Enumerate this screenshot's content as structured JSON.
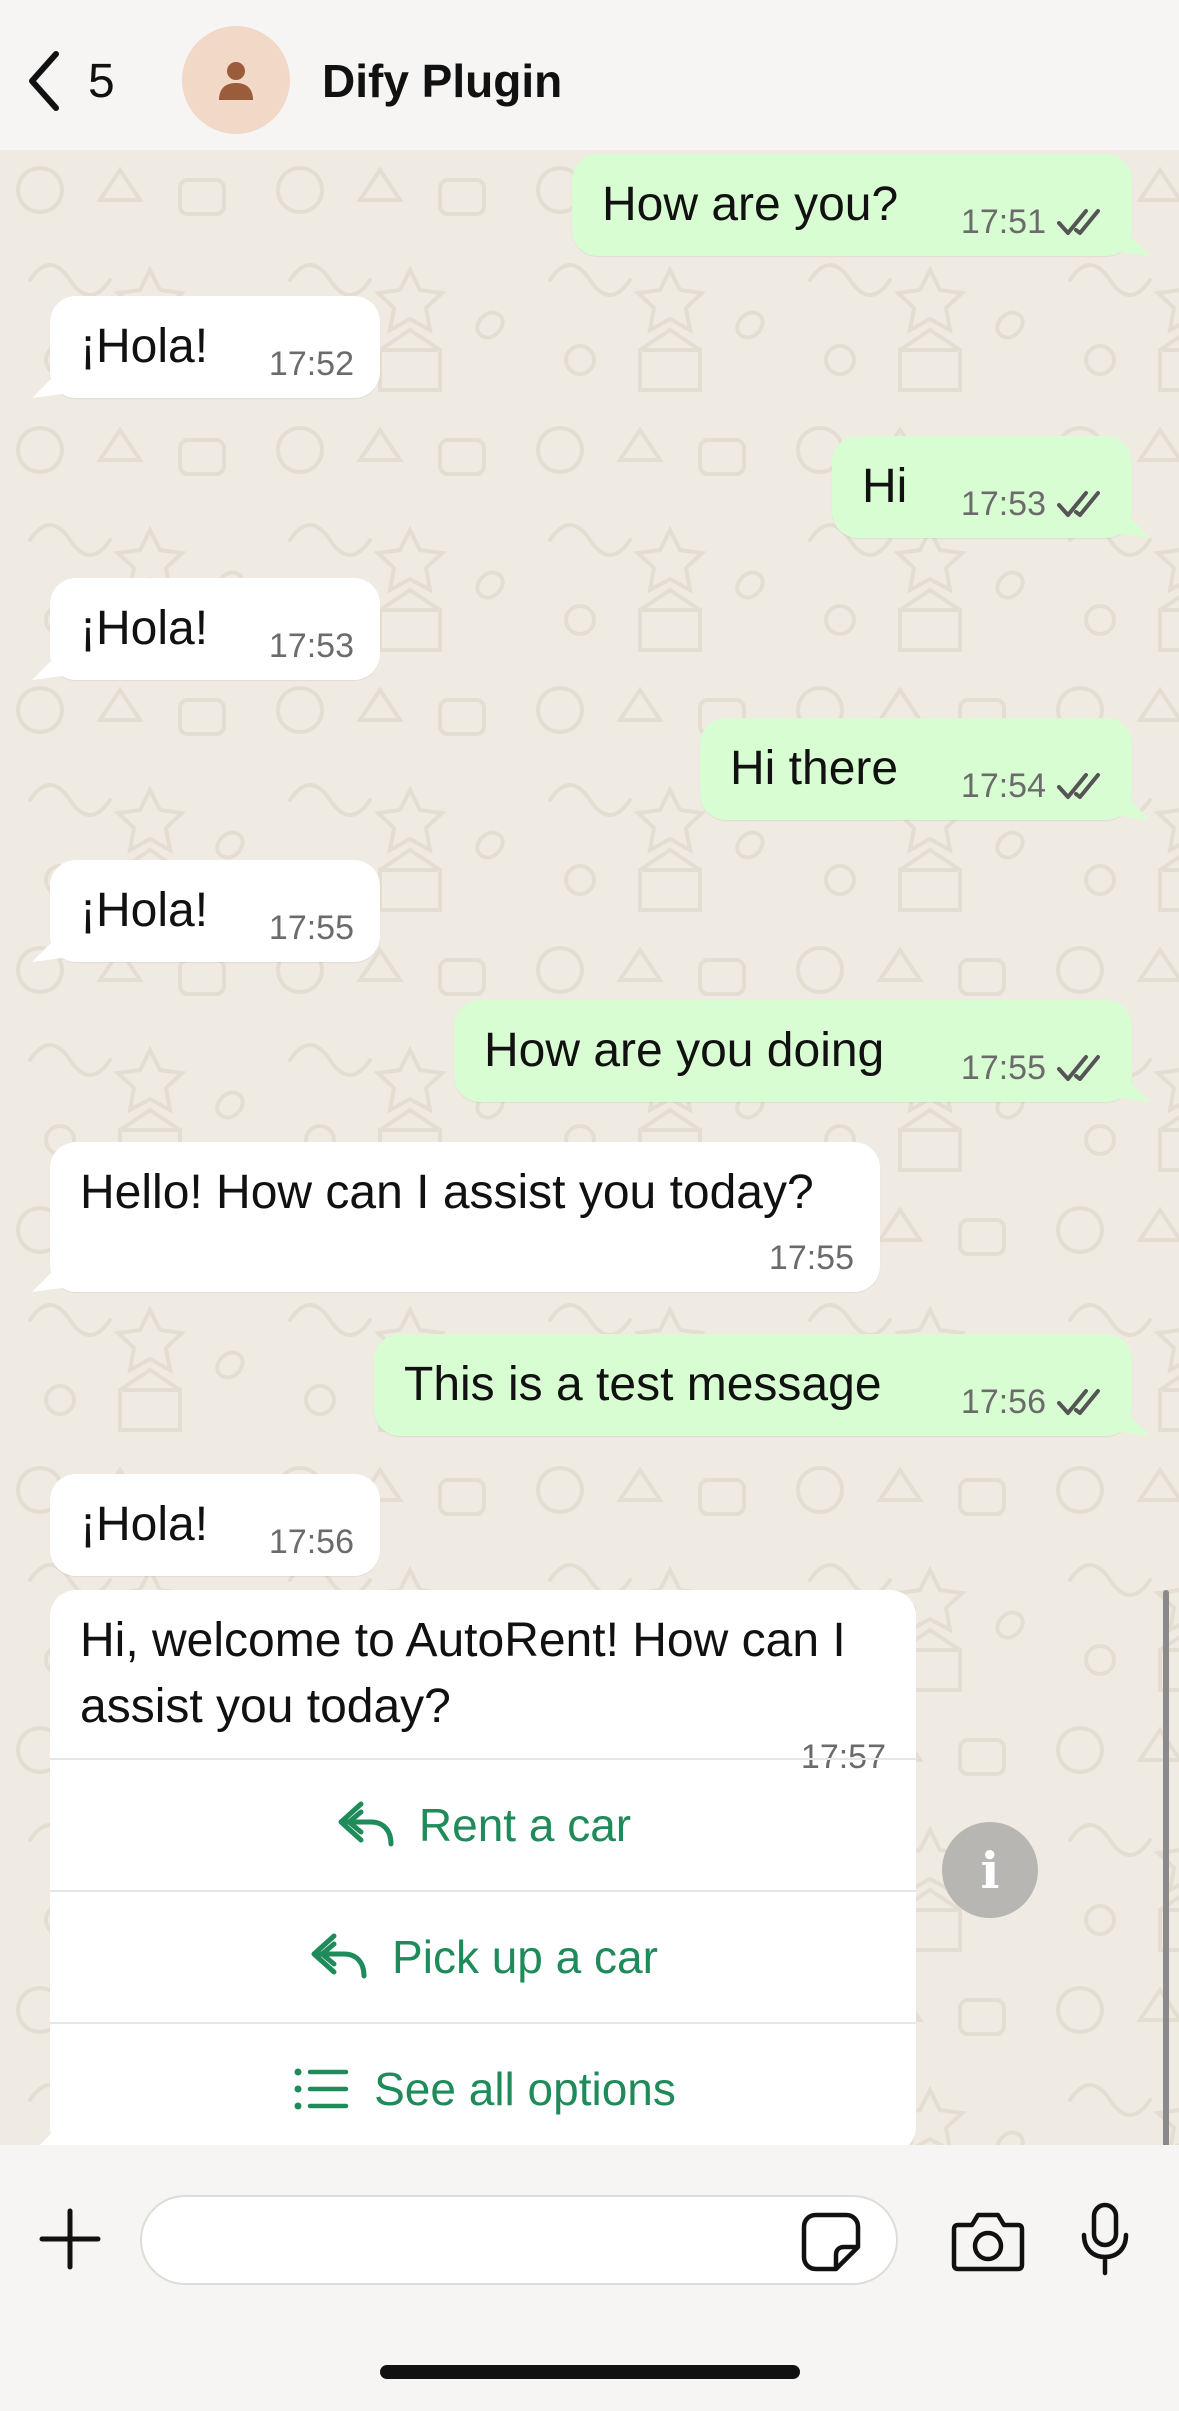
{
  "header": {
    "back_count": "5",
    "title": "Dify Plugin"
  },
  "messages": [
    {
      "dir": "out",
      "text": "How are you?",
      "time": "17:51"
    },
    {
      "dir": "in",
      "text": "¡Hola!",
      "time": "17:52"
    },
    {
      "dir": "out",
      "text": "Hi",
      "time": "17:53"
    },
    {
      "dir": "in",
      "text": "¡Hola!",
      "time": "17:53"
    },
    {
      "dir": "out",
      "text": "Hi there",
      "time": "17:54"
    },
    {
      "dir": "in",
      "text": "¡Hola!",
      "time": "17:55"
    },
    {
      "dir": "out",
      "text": "How are you doing",
      "time": "17:55"
    },
    {
      "dir": "in",
      "text": "Hello! How can I assist you today?",
      "time": "17:55"
    },
    {
      "dir": "out",
      "text": "This is a test message",
      "time": "17:56"
    },
    {
      "dir": "in",
      "text": "¡Hola!",
      "time": "17:56"
    }
  ],
  "card": {
    "text": "Hi, welcome to AutoRent! How can I assist you today?",
    "time": "17:57",
    "buttons": [
      {
        "label": "Rent a car",
        "icon": "reply-icon"
      },
      {
        "label": "Pick up a car",
        "icon": "reply-icon"
      },
      {
        "label": "See all options",
        "icon": "list-icon"
      }
    ]
  },
  "info_button": "i",
  "composer": {
    "placeholder": ""
  },
  "colors": {
    "outgoing_bubble": "#d9fdd3",
    "incoming_bubble": "#ffffff",
    "accent_green": "#1f8a5a",
    "chat_background": "#efeae2"
  }
}
